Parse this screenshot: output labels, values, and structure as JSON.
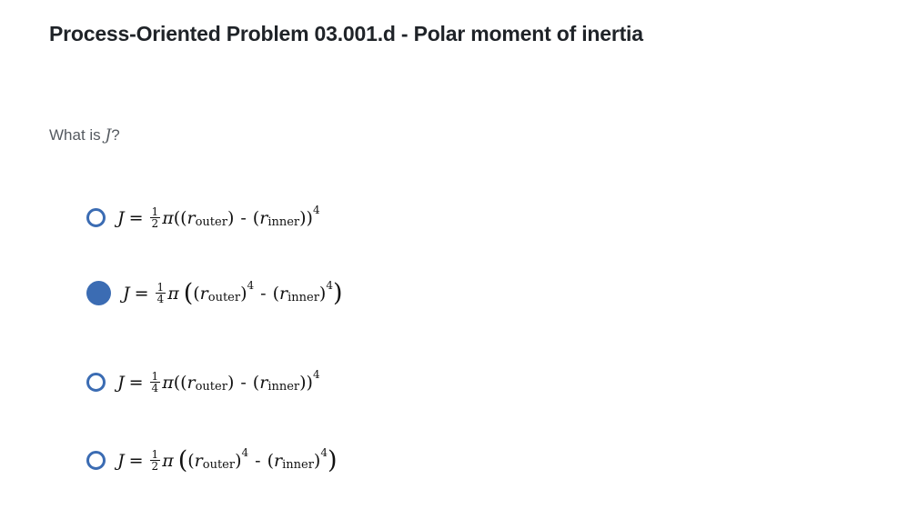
{
  "question": {
    "title": "Process-Oriented Problem 03.001.d - Polar moment of inertia",
    "prompt_prefix": "What is ",
    "prompt_var": "J",
    "prompt_suffix": "?"
  },
  "choices": [
    {
      "selected": false,
      "lhs": "J",
      "eq": "=",
      "num": "1",
      "den": "2",
      "pi": "π",
      "open": "((",
      "r": "r",
      "sub1": "outer",
      "close1": ")",
      "dash": "-",
      "open2": "(",
      "sub2": "inner",
      "close2": "))",
      "exp": "4"
    },
    {
      "selected": true,
      "lhs": "J",
      "eq": "=",
      "num": "1",
      "den": "4",
      "pi": "π",
      "open": "(",
      "open_b": "(",
      "r": "r",
      "sub1": "outer",
      "close1": ")",
      "exp1": "4",
      "dash": "-",
      "open2": "(",
      "sub2": "inner",
      "close2": ")",
      "exp2": "4",
      "close": ")"
    },
    {
      "selected": false,
      "lhs": "J",
      "eq": "=",
      "num": "1",
      "den": "4",
      "pi": "π",
      "open": "((",
      "r": "r",
      "sub1": "outer",
      "close1": ")",
      "dash": "-",
      "open2": "(",
      "sub2": "inner",
      "close2": "))",
      "exp": "4"
    },
    {
      "selected": false,
      "lhs": "J",
      "eq": "=",
      "num": "1",
      "den": "2",
      "pi": "π",
      "open": "(",
      "open_b": "(",
      "r": "r",
      "sub1": "outer",
      "close1": ")",
      "exp1": "4",
      "dash": "-",
      "open2": "(",
      "sub2": "inner",
      "close2": ")",
      "exp2": "4",
      "close": ")"
    }
  ]
}
